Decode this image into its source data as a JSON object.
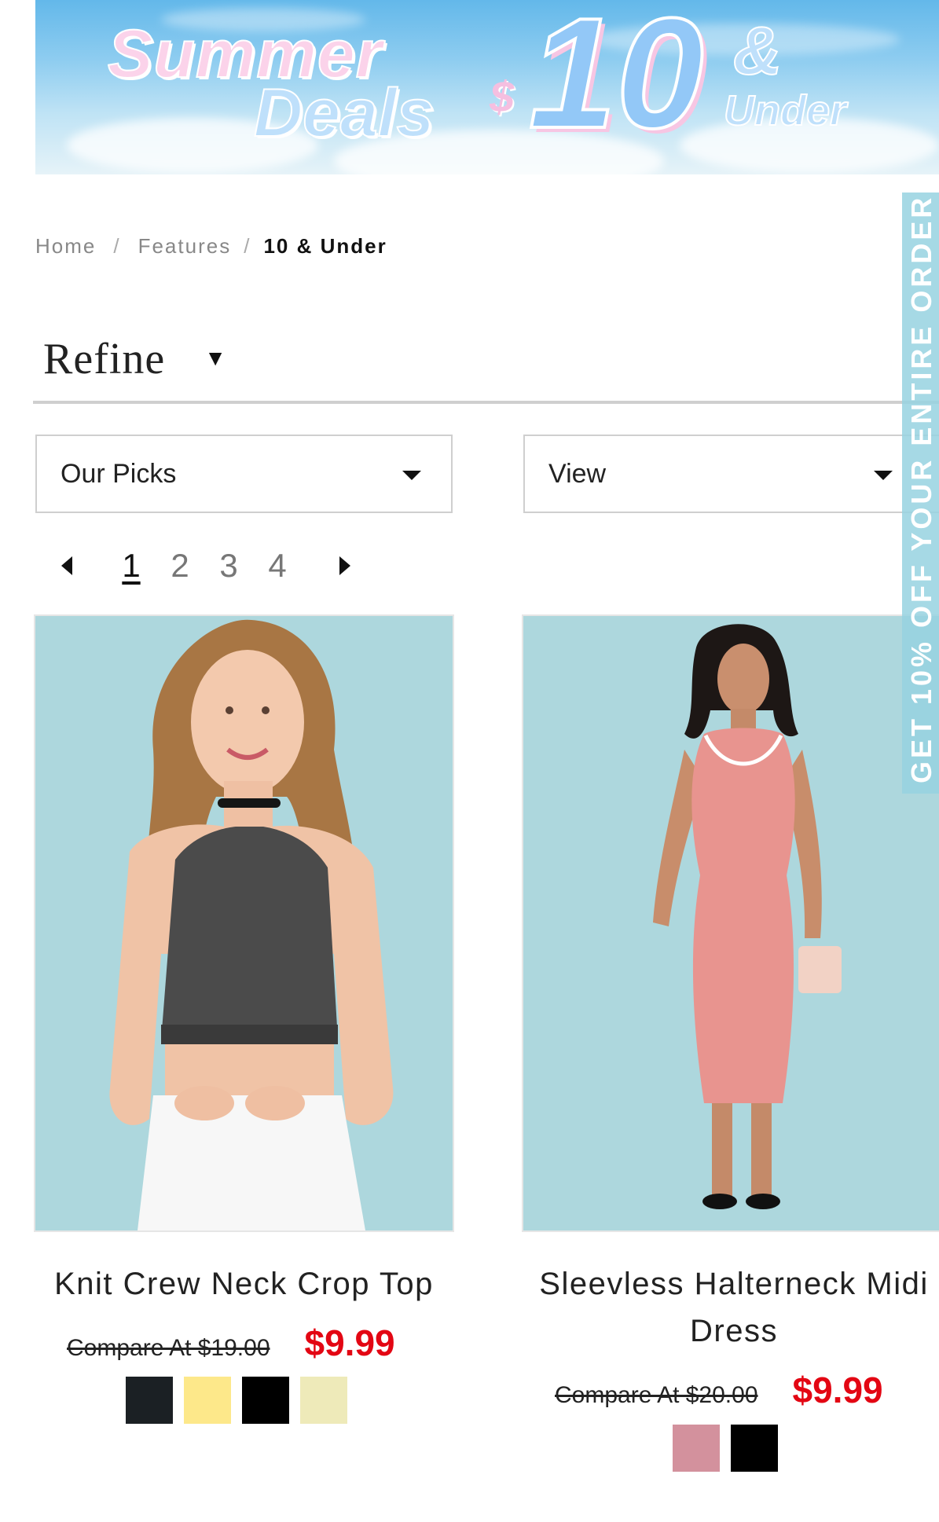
{
  "banner": {
    "line1": "Summer",
    "line2": "Deals",
    "currency": "$",
    "amount": "10",
    "ampersand": "&",
    "under": "Under"
  },
  "breadcrumb": {
    "items": [
      "Home",
      "Features"
    ],
    "separator": "/",
    "current": "10 & Under"
  },
  "refine": {
    "label": "Refine"
  },
  "filters": {
    "sort": {
      "selected": "Our Picks"
    },
    "view": {
      "selected": "View"
    }
  },
  "pagination": {
    "pages": [
      "1",
      "2",
      "3",
      "4"
    ],
    "current": "1"
  },
  "products": [
    {
      "title": "Knit Crew Neck Crop Top",
      "compare_price": "Compare At $19.00",
      "sale_price": "$9.99",
      "swatches": [
        "#1b2024",
        "#fde88a",
        "#000000",
        "#eeeab9"
      ]
    },
    {
      "title": "Sleevless Halterneck Midi Dress",
      "compare_price": "Compare At $20.00",
      "sale_price": "$9.99",
      "swatches": [
        "#d3919d",
        "#000000"
      ]
    }
  ],
  "side_tab": {
    "text": "GET 10% OFF YOUR ENTIRE ORDER"
  },
  "colors": {
    "sale_price": "#e30613",
    "image_background": "#add7dd",
    "side_tab": "#96d2e1"
  }
}
